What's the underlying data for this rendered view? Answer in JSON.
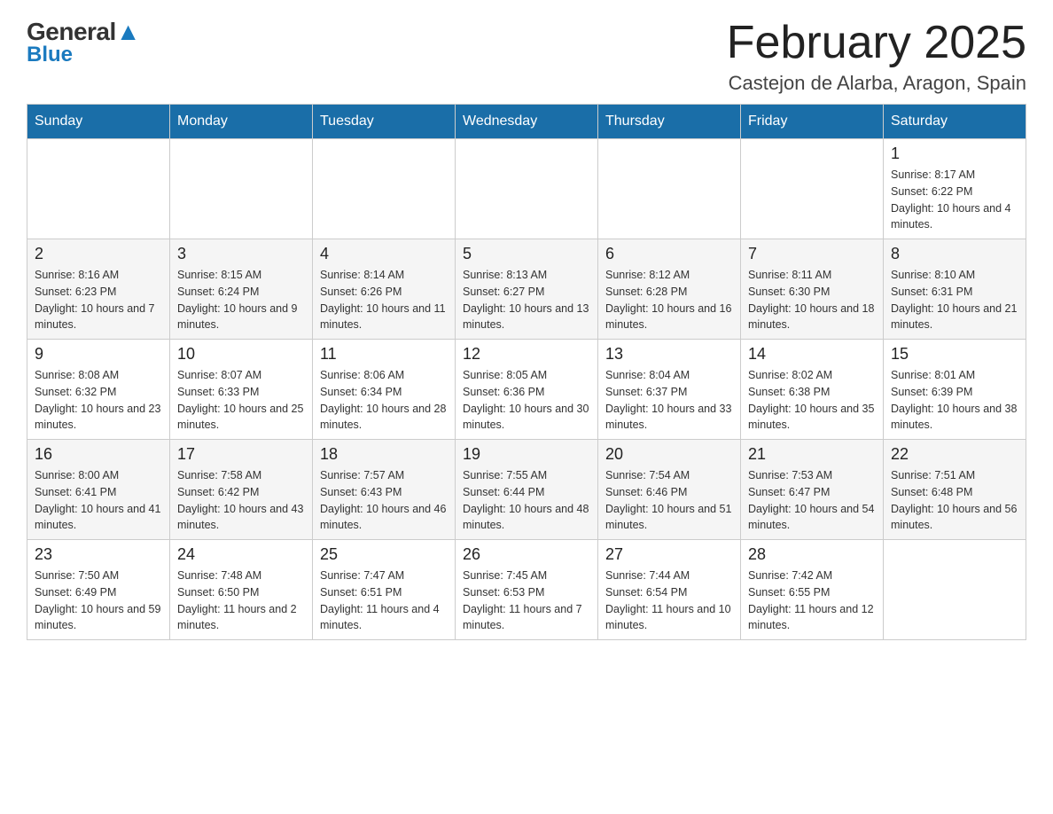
{
  "header": {
    "logo": {
      "general": "General",
      "blue": "Blue"
    },
    "title": "February 2025",
    "location": "Castejon de Alarba, Aragon, Spain"
  },
  "weekdays": [
    "Sunday",
    "Monday",
    "Tuesday",
    "Wednesday",
    "Thursday",
    "Friday",
    "Saturday"
  ],
  "weeks": [
    [
      {
        "day": "",
        "info": ""
      },
      {
        "day": "",
        "info": ""
      },
      {
        "day": "",
        "info": ""
      },
      {
        "day": "",
        "info": ""
      },
      {
        "day": "",
        "info": ""
      },
      {
        "day": "",
        "info": ""
      },
      {
        "day": "1",
        "info": "Sunrise: 8:17 AM\nSunset: 6:22 PM\nDaylight: 10 hours and 4 minutes."
      }
    ],
    [
      {
        "day": "2",
        "info": "Sunrise: 8:16 AM\nSunset: 6:23 PM\nDaylight: 10 hours and 7 minutes."
      },
      {
        "day": "3",
        "info": "Sunrise: 8:15 AM\nSunset: 6:24 PM\nDaylight: 10 hours and 9 minutes."
      },
      {
        "day": "4",
        "info": "Sunrise: 8:14 AM\nSunset: 6:26 PM\nDaylight: 10 hours and 11 minutes."
      },
      {
        "day": "5",
        "info": "Sunrise: 8:13 AM\nSunset: 6:27 PM\nDaylight: 10 hours and 13 minutes."
      },
      {
        "day": "6",
        "info": "Sunrise: 8:12 AM\nSunset: 6:28 PM\nDaylight: 10 hours and 16 minutes."
      },
      {
        "day": "7",
        "info": "Sunrise: 8:11 AM\nSunset: 6:30 PM\nDaylight: 10 hours and 18 minutes."
      },
      {
        "day": "8",
        "info": "Sunrise: 8:10 AM\nSunset: 6:31 PM\nDaylight: 10 hours and 21 minutes."
      }
    ],
    [
      {
        "day": "9",
        "info": "Sunrise: 8:08 AM\nSunset: 6:32 PM\nDaylight: 10 hours and 23 minutes."
      },
      {
        "day": "10",
        "info": "Sunrise: 8:07 AM\nSunset: 6:33 PM\nDaylight: 10 hours and 25 minutes."
      },
      {
        "day": "11",
        "info": "Sunrise: 8:06 AM\nSunset: 6:34 PM\nDaylight: 10 hours and 28 minutes."
      },
      {
        "day": "12",
        "info": "Sunrise: 8:05 AM\nSunset: 6:36 PM\nDaylight: 10 hours and 30 minutes."
      },
      {
        "day": "13",
        "info": "Sunrise: 8:04 AM\nSunset: 6:37 PM\nDaylight: 10 hours and 33 minutes."
      },
      {
        "day": "14",
        "info": "Sunrise: 8:02 AM\nSunset: 6:38 PM\nDaylight: 10 hours and 35 minutes."
      },
      {
        "day": "15",
        "info": "Sunrise: 8:01 AM\nSunset: 6:39 PM\nDaylight: 10 hours and 38 minutes."
      }
    ],
    [
      {
        "day": "16",
        "info": "Sunrise: 8:00 AM\nSunset: 6:41 PM\nDaylight: 10 hours and 41 minutes."
      },
      {
        "day": "17",
        "info": "Sunrise: 7:58 AM\nSunset: 6:42 PM\nDaylight: 10 hours and 43 minutes."
      },
      {
        "day": "18",
        "info": "Sunrise: 7:57 AM\nSunset: 6:43 PM\nDaylight: 10 hours and 46 minutes."
      },
      {
        "day": "19",
        "info": "Sunrise: 7:55 AM\nSunset: 6:44 PM\nDaylight: 10 hours and 48 minutes."
      },
      {
        "day": "20",
        "info": "Sunrise: 7:54 AM\nSunset: 6:46 PM\nDaylight: 10 hours and 51 minutes."
      },
      {
        "day": "21",
        "info": "Sunrise: 7:53 AM\nSunset: 6:47 PM\nDaylight: 10 hours and 54 minutes."
      },
      {
        "day": "22",
        "info": "Sunrise: 7:51 AM\nSunset: 6:48 PM\nDaylight: 10 hours and 56 minutes."
      }
    ],
    [
      {
        "day": "23",
        "info": "Sunrise: 7:50 AM\nSunset: 6:49 PM\nDaylight: 10 hours and 59 minutes."
      },
      {
        "day": "24",
        "info": "Sunrise: 7:48 AM\nSunset: 6:50 PM\nDaylight: 11 hours and 2 minutes."
      },
      {
        "day": "25",
        "info": "Sunrise: 7:47 AM\nSunset: 6:51 PM\nDaylight: 11 hours and 4 minutes."
      },
      {
        "day": "26",
        "info": "Sunrise: 7:45 AM\nSunset: 6:53 PM\nDaylight: 11 hours and 7 minutes."
      },
      {
        "day": "27",
        "info": "Sunrise: 7:44 AM\nSunset: 6:54 PM\nDaylight: 11 hours and 10 minutes."
      },
      {
        "day": "28",
        "info": "Sunrise: 7:42 AM\nSunset: 6:55 PM\nDaylight: 11 hours and 12 minutes."
      },
      {
        "day": "",
        "info": ""
      }
    ]
  ]
}
